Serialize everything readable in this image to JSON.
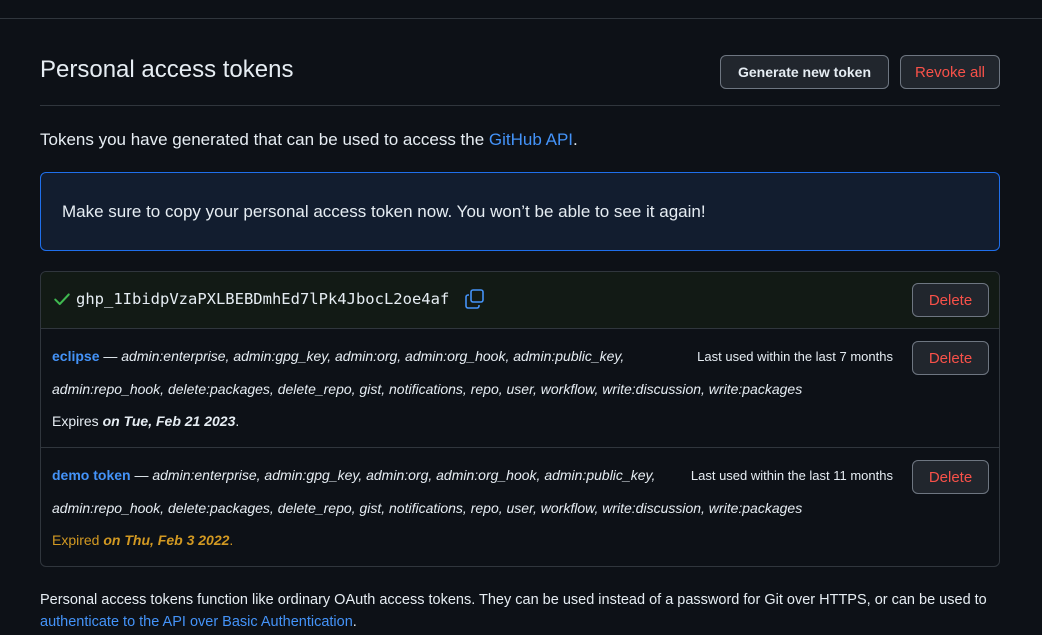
{
  "header": {
    "title": "Personal access tokens",
    "generate_label": "Generate new token",
    "revoke_label": "Revoke all"
  },
  "intro": {
    "text": "Tokens you have generated that can be used to access the ",
    "link": "GitHub API",
    "suffix": "."
  },
  "flash": {
    "message": "Make sure to copy your personal access token now. You won’t be able to see it again!"
  },
  "new_token": {
    "value": "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",
    "delete_label": "Delete"
  },
  "tokens": [
    {
      "name": "eclipse",
      "dash": " — ",
      "scopes_line1": "admin:enterprise, admin:gpg_key, admin:org, admin:org_hook, admin:public_key,",
      "scopes_line2": "admin:repo_hook, delete:packages, delete_repo, gist, notifications, repo, user, workflow, write:discussion, write:packages",
      "last_used": "Last used within the last 7 months",
      "expires_prefix": "Expires ",
      "expires_date": "on Tue, Feb 21 2023",
      "expires_suffix": ".",
      "delete_label": "Delete"
    },
    {
      "name": "demo token",
      "dash": " — ",
      "scopes_line1": "admin:enterprise, admin:gpg_key, admin:org, admin:org_hook, admin:public_key,",
      "scopes_line2": "admin:repo_hook, delete:packages, delete_repo, gist, notifications, repo, user, workflow, write:discussion, write:packages",
      "last_used": "Last used within the last 11 months",
      "expires_prefix": "Expired ",
      "expires_date": "on Thu, Feb 3 2022",
      "expires_suffix": ".",
      "delete_label": "Delete"
    }
  ],
  "footer": {
    "text": "Personal access tokens function like ordinary OAuth access tokens. They can be used instead of a password for Git over HTTPS, or can be used to",
    "link": "authenticate to the API over Basic Authentication",
    "suffix": "."
  },
  "colors": {
    "background": "#0d1117",
    "link": "#4493f8",
    "danger": "#f85149",
    "warning": "#d29922",
    "success": "#3fb950"
  }
}
